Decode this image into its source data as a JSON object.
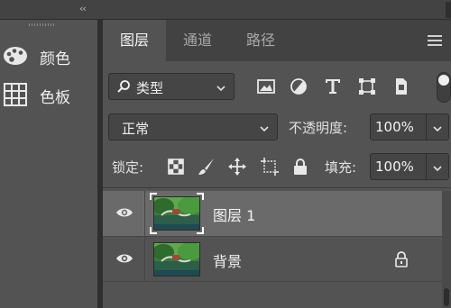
{
  "topbar": {
    "collapse_label": "‹‹"
  },
  "dock": {
    "items": [
      {
        "label": "颜色",
        "icon": "palette-icon"
      },
      {
        "label": "色板",
        "icon": "swatches-grid-icon"
      }
    ]
  },
  "tabs": [
    {
      "label": "图层",
      "active": true
    },
    {
      "label": "通道",
      "active": false
    },
    {
      "label": "路径",
      "active": false
    }
  ],
  "filter": {
    "kind_label": "类型",
    "icons": [
      "pixel-filter-icon",
      "adjustment-filter-icon",
      "type-filter-icon",
      "shape-filter-icon",
      "smart-object-filter-icon"
    ]
  },
  "blend": {
    "mode": "正常",
    "opacity_label": "不透明度:",
    "opacity_value": "100%"
  },
  "lock": {
    "label": "锁定:",
    "icons": [
      "lock-transparent-pixels-icon",
      "lock-image-pixels-icon",
      "lock-position-icon",
      "lock-artboard-icon",
      "lock-all-icon"
    ],
    "fill_label": "填充:",
    "fill_value": "100%"
  },
  "layers": [
    {
      "name": "图层 1",
      "selected": true,
      "visible": true,
      "locked": false
    },
    {
      "name": "背景",
      "selected": false,
      "visible": true,
      "locked": true
    }
  ],
  "colors": {
    "panel_bg": "#535353",
    "tab_bar_bg": "#424242",
    "selected_row": "#6a6a6a",
    "field_bg": "#454545"
  }
}
